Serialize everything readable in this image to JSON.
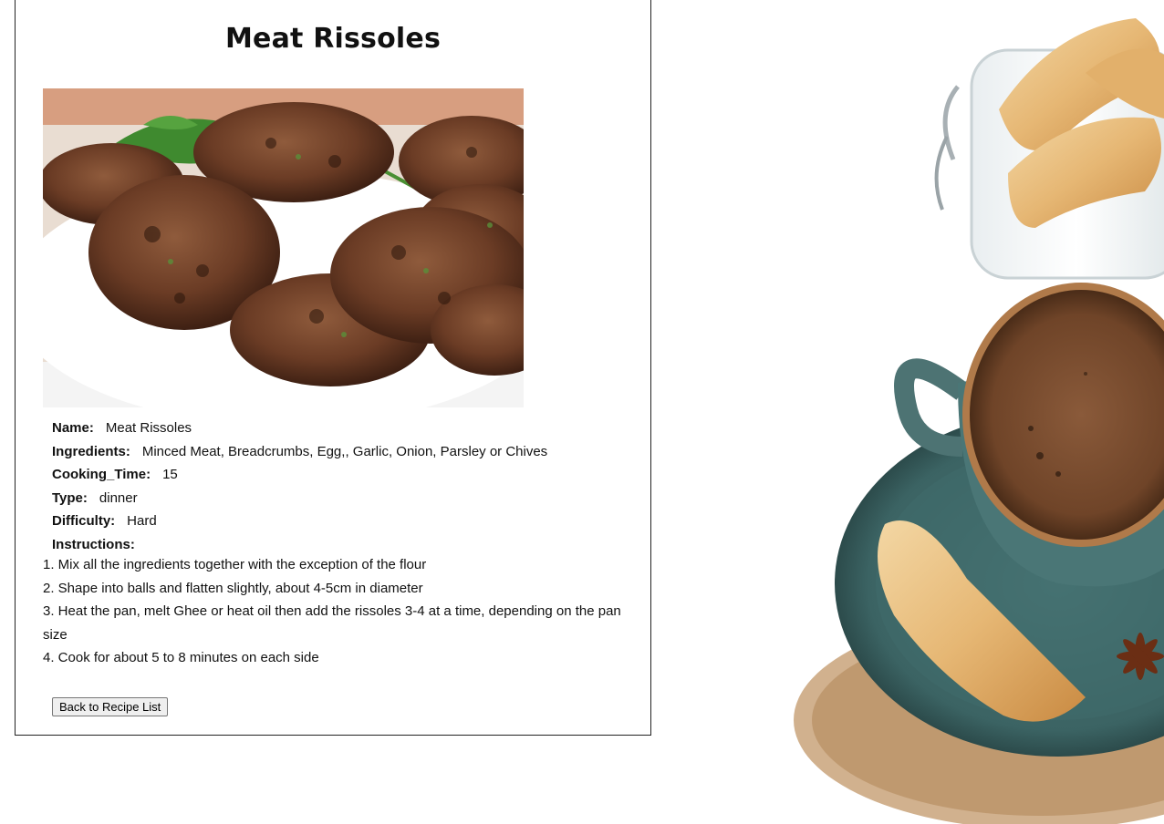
{
  "recipe": {
    "title": "Meat Rissoles",
    "photo_alt": "",
    "fields": [
      {
        "label": "Name:",
        "value": "Meat Rissoles"
      },
      {
        "label": "Ingredients:",
        "value": "Minced Meat, Breadcrumbs, Egg,, Garlic, Onion, Parsley or Chives"
      },
      {
        "label": "Cooking_Time:",
        "value": "15"
      },
      {
        "label": "Type:",
        "value": "dinner"
      },
      {
        "label": "Difficulty:",
        "value": "Hard"
      }
    ],
    "instructions_label": "Instructions:",
    "instructions": [
      "1. Mix all the ingredients together with the exception of the flour",
      "2. Shape into balls and flatten slightly, about 4-5cm in diameter",
      "3. Heat the pan, melt Ghee or heat oil then add the rissoles 3-4 at a time, depending on the pan size",
      "4. Cook for about 5 to 8 minutes on each side"
    ],
    "back_button_label": "Back to Recipe List"
  },
  "colors": {
    "border": "#222222",
    "text": "#111111",
    "button_bg": "#efefef"
  }
}
